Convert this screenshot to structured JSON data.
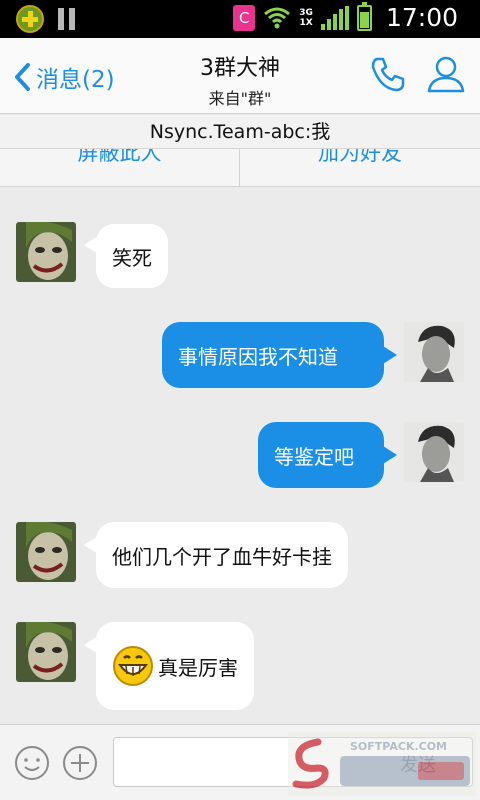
{
  "status_bar": {
    "time": "17:00",
    "network": "3G\n1X",
    "battery_level": 0.7,
    "c_badge": "C"
  },
  "header": {
    "back_label": "消息(2)",
    "title": "3群大神",
    "subtitle": "来自\"群\""
  },
  "notice": {
    "text": "Nsync.Team-abc:我"
  },
  "actions": {
    "block": "屏蔽此人",
    "add_friend": "加为好友"
  },
  "messages": [
    {
      "side": "in",
      "text": "笑死",
      "has_emoji": false
    },
    {
      "side": "out",
      "text": "事情原因我不知道",
      "has_emoji": false
    },
    {
      "side": "out",
      "text": "等鉴定吧",
      "has_emoji": false
    },
    {
      "side": "in",
      "text": "他们几个开了血牛好卡挂",
      "has_emoji": false
    },
    {
      "side": "in",
      "text": "真是厉害",
      "has_emoji": true,
      "emoji": "grin-emoji"
    }
  ],
  "input_bar": {
    "send_label": "发送",
    "placeholder": ""
  },
  "watermark": {
    "text": "SOFTPACK.COM"
  },
  "colors": {
    "accent": "#1c8fe2",
    "out_bubble": "#1b8ee6",
    "in_bubble": "#ffffff",
    "background": "#ebebeb"
  }
}
